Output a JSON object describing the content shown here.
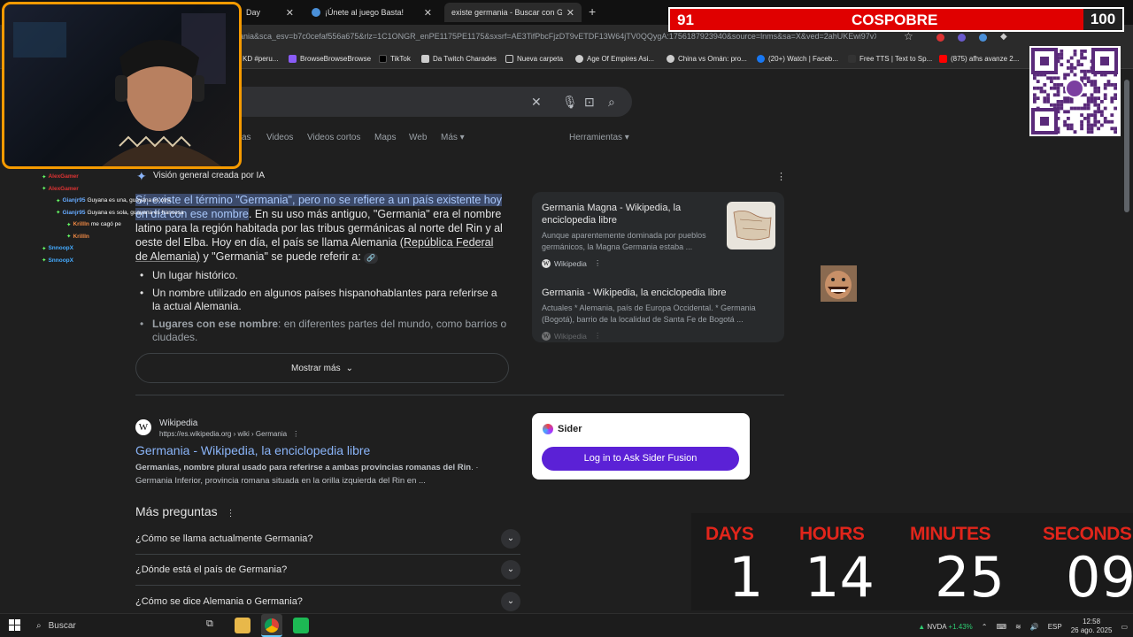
{
  "tabs": [
    {
      "label": "Day"
    },
    {
      "label": "¡Únete al juego Basta!"
    },
    {
      "label": "existe germania - Buscar con G"
    }
  ],
  "address": {
    "url": "ania&sca_esv=b7c0cefaf556a675&rlz=1C1ONGR_enPE1175PE1175&sxsrf=AE3TifPbcFjzDT9vETDF13W64jTV0QQygA:1756187923940&source=lnms&sa=X&ved=2ahUKEwi97vXq"
  },
  "bookmarks": [
    "KD #peru...",
    "BrowseBrowseBrowse",
    "TikTok",
    "Da Twitch Charades",
    "Nueva carpeta",
    "Age Of Empires Asi...",
    "China vs Omán: pro...",
    "(20+) Watch | Faceb...",
    "Free TTS | Text to Sp...",
    "(875) afhs avanze 2..."
  ],
  "nav_tabs": [
    "as",
    "Videos",
    "Videos cortos",
    "Maps",
    "Web",
    "Más ▾"
  ],
  "tools": "Herramientas ▾",
  "ai": {
    "title": "Visión general creada por IA",
    "para_hl": "Sí, existe el término \"Germania\", pero no se refiere a un país existente hoy en día con ese nombre",
    "para_rest_1": ". En su uso más antiguo, \"Germania\" era el nombre latino para la región habitada por las tribus germánicas al norte del Rin y al oeste del Elba. Hoy en día, el país se llama Alemania ",
    "para_link": "(República Federal de Alemania)",
    "para_rest_2": " y \"Germania\" se puede referir a:",
    "bullets": [
      "Un lugar histórico.",
      "Un nombre utilizado en algunos países hispanohablantes para referirse a la actual Alemania."
    ],
    "bullet3_bold": "Lugares con ese nombre",
    "bullet3_rest": ": en diferentes partes del mundo, como barrios o ciudades.",
    "more": "Mostrar más"
  },
  "sources": [
    {
      "title": "Germania Magna - Wikipedia, la enciclopedia libre",
      "desc": "Aunque aparentemente dominada por pueblos germánicos, la Magna Germania estaba ...",
      "site": "Wikipedia"
    },
    {
      "title": "Germania - Wikipedia, la enciclopedia libre",
      "desc": "Actuales * Alemania, país de Europa Occidental. * Germania (Bogotá), barrio de la localidad de Santa Fe de Bogotá ...",
      "site": "Wikipedia"
    }
  ],
  "result": {
    "site": "Wikipedia",
    "url": "https://es.wikipedia.org › wiki › Germania",
    "title": "Germania - Wikipedia, la enciclopedia libre",
    "snippet_bold": "Germanias, nombre plural usado para referirse a ambas provincias romanas del Rin",
    "snippet_rest": ". · Germania Inferior, provincia romana situada en la orilla izquierda del Rin en ..."
  },
  "questions": {
    "title": "Más preguntas",
    "items": [
      "¿Cómo se llama actualmente Germania?",
      "¿Dónde está el país de Germania?",
      "¿Cómo se dice Alemania o Germania?"
    ]
  },
  "sider": {
    "title": "Sider",
    "button": "Log in to Ask Sider Fusion"
  },
  "overlay": {
    "bar_left": "91",
    "bar_mid": "COSPOBRE",
    "bar_right": "100",
    "countdown": [
      {
        "label": "DAYS",
        "value": "1"
      },
      {
        "label": "HOURS",
        "value": "14"
      },
      {
        "label": "MINUTES",
        "value": "25"
      },
      {
        "label": "SECONDS",
        "value": "09"
      }
    ],
    "chat": [
      {
        "user": "AlexGamer",
        "msg": "",
        "color": "#d33"
      },
      {
        "user": "AlexGamer",
        "msg": "",
        "color": "#d33"
      },
      {
        "user": "Gianjr95",
        "msg": "Guyana es una, guayana es otra",
        "color": "#6af"
      },
      {
        "user": "Gianjr95",
        "msg": "Guyana es sola, guayana es francesa",
        "color": "#6af"
      },
      {
        "user": "KrillIn",
        "msg": "me cagó pe",
        "color": "#e84"
      },
      {
        "user": "KrillIn",
        "msg": "",
        "color": "#e84"
      },
      {
        "user": "SnnoopX",
        "msg": "",
        "color": "#4af"
      },
      {
        "user": "SnnoopX",
        "msg": "",
        "color": "#4af"
      }
    ]
  },
  "taskbar": {
    "search": "Buscar",
    "stock": "NVDA",
    "stock_change": "+1.43%",
    "lang": "ESP",
    "time": "12:58",
    "date": "26 ago. 2025"
  }
}
